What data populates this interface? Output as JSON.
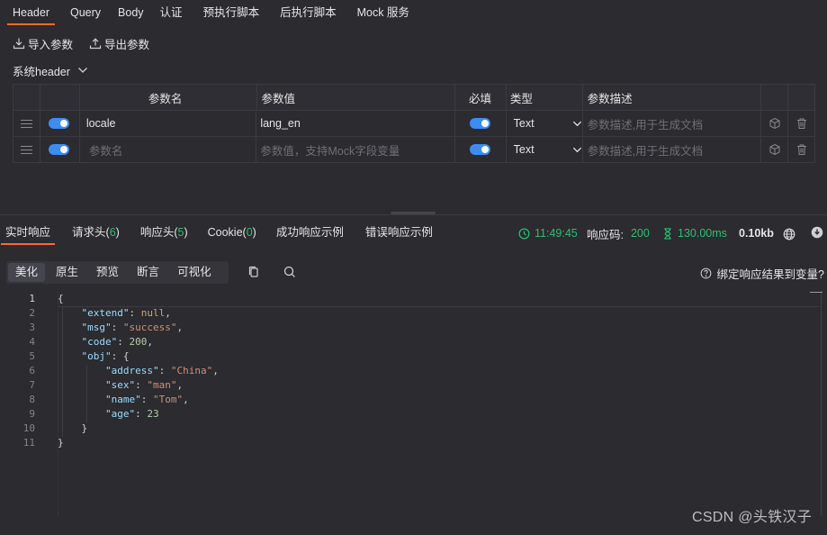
{
  "top_tabs": [
    {
      "label": "Header",
      "active": true
    },
    {
      "label": "Query"
    },
    {
      "label": "Body"
    },
    {
      "label": "认证"
    },
    {
      "label": "预执行脚本"
    },
    {
      "label": "后执行脚本"
    },
    {
      "label": "Mock 服务"
    }
  ],
  "io": {
    "import_label": "导入参数",
    "export_label": "导出参数"
  },
  "system_header_label": "系统header",
  "params_table": {
    "headers": {
      "name": "参数名",
      "value": "参数值",
      "required": "必填",
      "type": "类型",
      "desc": "参数描述"
    },
    "rows": [
      {
        "name": "locale",
        "value": "lang_en",
        "type": "Text",
        "desc_placeholder": "参数描述,用于生成文档",
        "enabled": true,
        "required": true
      },
      {
        "name_placeholder": "参数名",
        "value_placeholder": "参数值，支持Mock字段变量",
        "type": "Text",
        "desc_placeholder": "参数描述,用于生成文档",
        "enabled": true,
        "required": true
      }
    ]
  },
  "response_tabs": [
    {
      "label": "实时响应",
      "active": true
    },
    {
      "label": "请求头(",
      "count": "6",
      "suffix": ")"
    },
    {
      "label": "响应头(",
      "count": "5",
      "suffix": ")"
    },
    {
      "label": "Cookie(",
      "count": "0",
      "suffix": ")"
    },
    {
      "label": "成功响应示例"
    },
    {
      "label": "错误响应示例"
    }
  ],
  "response_meta": {
    "time": "11:49:45",
    "code_label": "响应码:",
    "code": "200",
    "duration": "130.00ms",
    "size": "0.10kb"
  },
  "view_tabs": [
    {
      "label": "美化",
      "active": true
    },
    {
      "label": "原生"
    },
    {
      "label": "预览"
    },
    {
      "label": "断言"
    },
    {
      "label": "可视化"
    }
  ],
  "bind_label": "绑定响应结果到变量?",
  "code_lines": [
    {
      "num": "1",
      "indent": 0,
      "tokens": [
        {
          "t": "{",
          "c": ""
        }
      ]
    },
    {
      "num": "2",
      "indent": 1,
      "tokens": [
        {
          "t": "\"extend\"",
          "c": "k"
        },
        {
          "t": ": ",
          "c": ""
        },
        {
          "t": "null",
          "c": "nl"
        },
        {
          "t": ",",
          "c": ""
        }
      ]
    },
    {
      "num": "3",
      "indent": 1,
      "tokens": [
        {
          "t": "\"msg\"",
          "c": "k"
        },
        {
          "t": ": ",
          "c": ""
        },
        {
          "t": "\"success\"",
          "c": "s"
        },
        {
          "t": ",",
          "c": ""
        }
      ]
    },
    {
      "num": "4",
      "indent": 1,
      "tokens": [
        {
          "t": "\"code\"",
          "c": "k"
        },
        {
          "t": ": ",
          "c": ""
        },
        {
          "t": "200",
          "c": "n"
        },
        {
          "t": ",",
          "c": ""
        }
      ]
    },
    {
      "num": "5",
      "indent": 1,
      "tokens": [
        {
          "t": "\"obj\"",
          "c": "k"
        },
        {
          "t": ": {",
          "c": ""
        }
      ]
    },
    {
      "num": "6",
      "indent": 2,
      "tokens": [
        {
          "t": "\"address\"",
          "c": "k"
        },
        {
          "t": ": ",
          "c": ""
        },
        {
          "t": "\"China\"",
          "c": "s"
        },
        {
          "t": ",",
          "c": ""
        }
      ]
    },
    {
      "num": "7",
      "indent": 2,
      "tokens": [
        {
          "t": "\"sex\"",
          "c": "k"
        },
        {
          "t": ": ",
          "c": ""
        },
        {
          "t": "\"man\"",
          "c": "s"
        },
        {
          "t": ",",
          "c": ""
        }
      ]
    },
    {
      "num": "8",
      "indent": 2,
      "tokens": [
        {
          "t": "\"name\"",
          "c": "k"
        },
        {
          "t": ": ",
          "c": ""
        },
        {
          "t": "\"Tom\"",
          "c": "s"
        },
        {
          "t": ",",
          "c": ""
        }
      ]
    },
    {
      "num": "9",
      "indent": 2,
      "tokens": [
        {
          "t": "\"age\"",
          "c": "k"
        },
        {
          "t": ": ",
          "c": ""
        },
        {
          "t": "23",
          "c": "n"
        }
      ]
    },
    {
      "num": "10",
      "indent": 1,
      "tokens": [
        {
          "t": "}",
          "c": ""
        }
      ]
    },
    {
      "num": "11",
      "indent": 0,
      "tokens": [
        {
          "t": "}",
          "c": ""
        }
      ]
    }
  ],
  "watermark": "CSDN @头铁汉子",
  "colors": {
    "accent": "#ff6a2b",
    "toggle": "#3d8cf0",
    "success": "#2fbf71",
    "background": "#2b2b30"
  }
}
